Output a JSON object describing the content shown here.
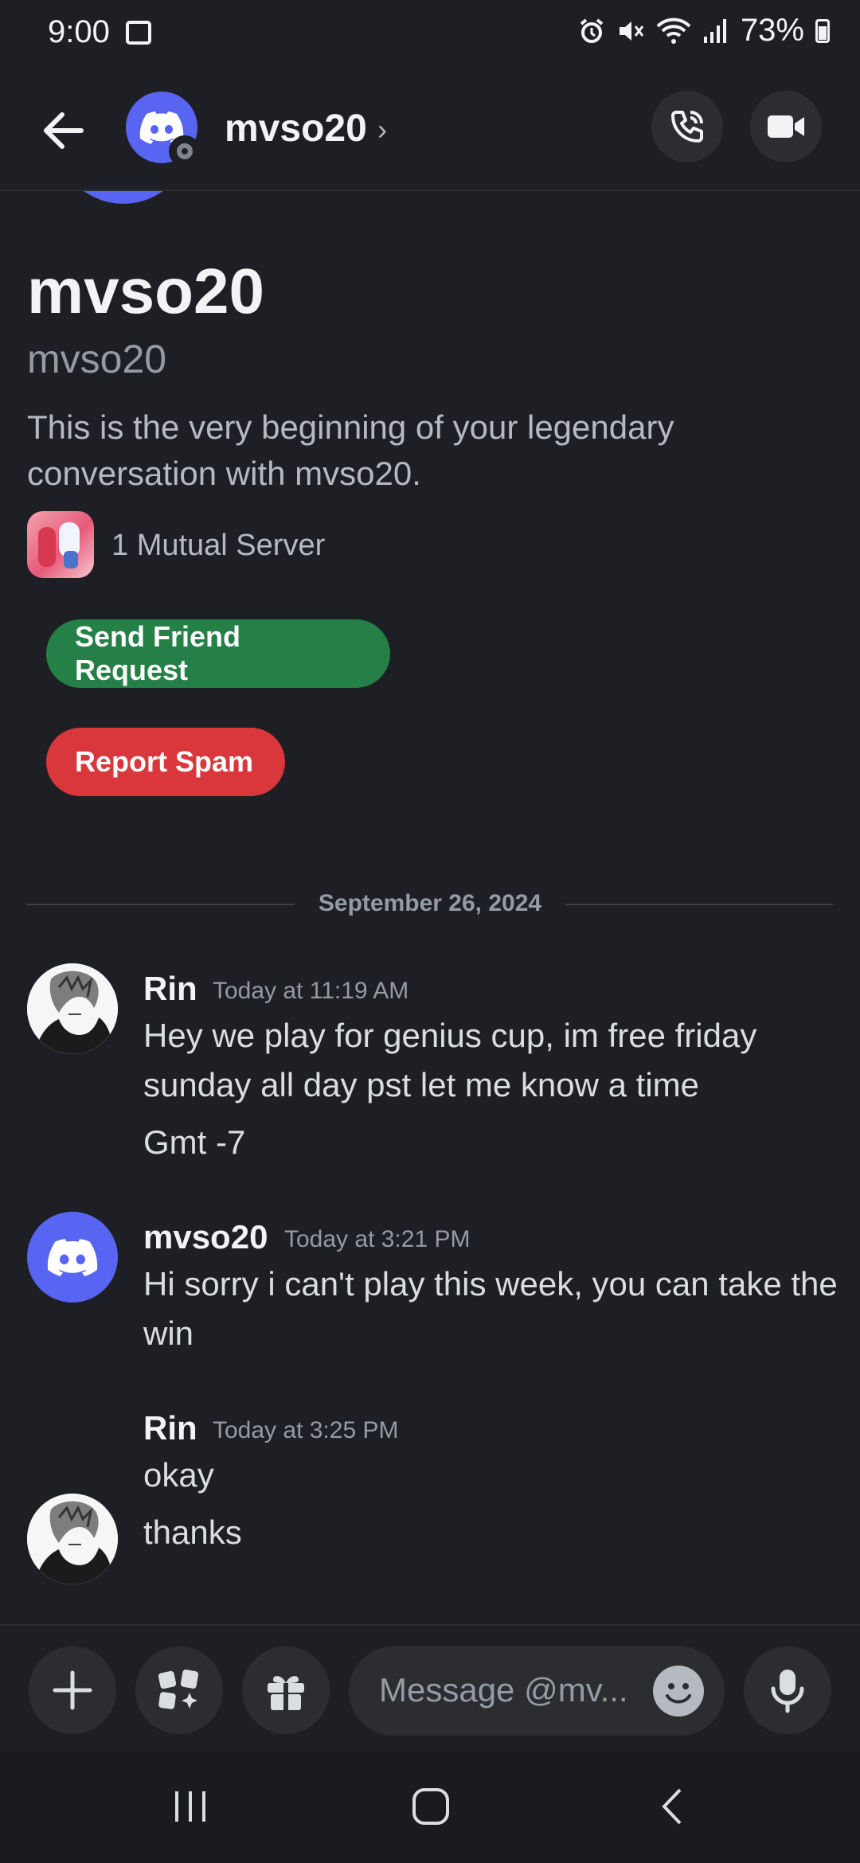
{
  "status_bar": {
    "time": "9:00",
    "battery": "73%"
  },
  "header": {
    "name": "mvso20",
    "chevron": "›"
  },
  "intro": {
    "display_name": "mvso20",
    "username": "mvso20",
    "description": "This is the very beginning of your legendary conversation with mvso20.",
    "mutual_servers": "1 Mutual Server",
    "send_friend_request": "Send Friend Request",
    "report_spam": "Report Spam"
  },
  "date_divider": "September 26, 2024",
  "messages": [
    {
      "author": "Rin",
      "time": "Today at 11:19 AM",
      "lines": [
        "Hey we play for genius cup, im free friday sunday all day pst let me know a time",
        "Gmt -7"
      ]
    },
    {
      "author": "mvso20",
      "time": "Today at 3:21 PM",
      "lines": [
        "Hi sorry i can't play this week, you can take the win"
      ]
    },
    {
      "author": "Rin",
      "time": "Today at 3:25 PM",
      "lines": [
        "okay",
        "thanks"
      ]
    }
  ],
  "composer": {
    "placeholder": "Message @mv..."
  },
  "colors": {
    "blurple": "#5865f2",
    "green": "#248046",
    "red": "#da373c",
    "background": "#1e1f24"
  }
}
